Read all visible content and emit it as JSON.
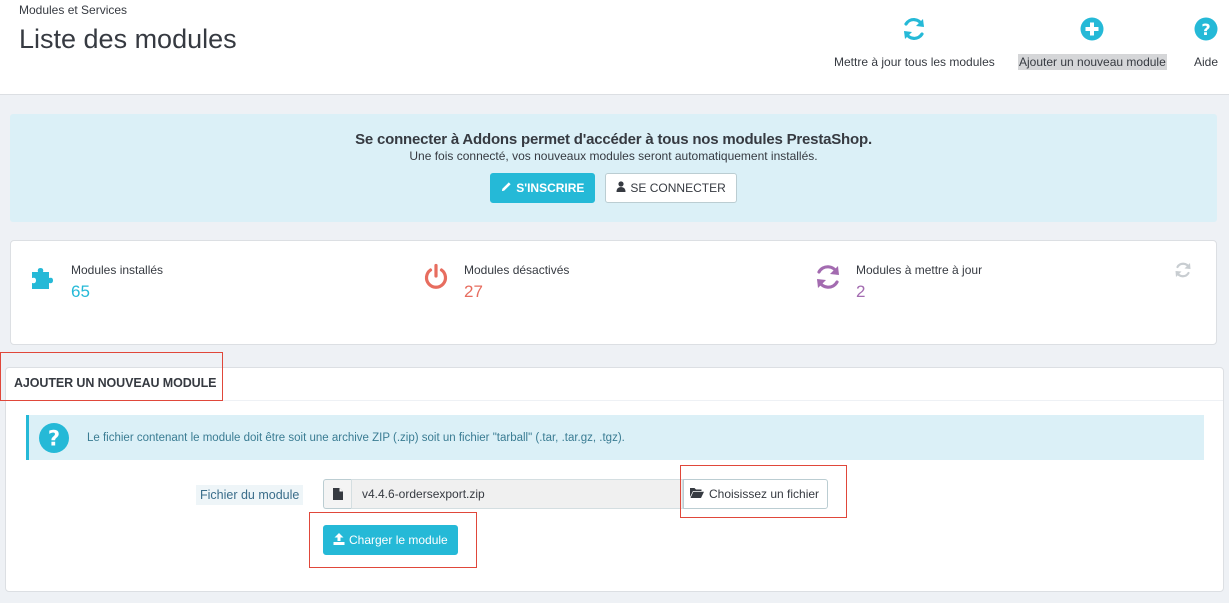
{
  "header": {
    "breadcrumb": "Modules et Services",
    "title": "Liste des modules",
    "toolbar": [
      {
        "label": "Mettre à jour tous les modules",
        "icon": "refresh-icon"
      },
      {
        "label": "Ajouter un nouveau module",
        "icon": "plus-circle-icon"
      },
      {
        "label": "Aide",
        "icon": "help-icon"
      }
    ]
  },
  "addons": {
    "title": "Se connecter à Addons permet d'accéder à tous nos modules PrestaShop.",
    "subtitle": "Une fois connecté, vos nouveaux modules seront automatiquement installés.",
    "signup_label": "S'INSCRIRE",
    "login_label": "SE CONNECTER"
  },
  "stats": {
    "installed": {
      "label": "Modules installés",
      "value": "65",
      "color": "#25b9d7"
    },
    "disabled": {
      "label": "Modules désactivés",
      "value": "27",
      "color": "#e76d5f"
    },
    "to_update": {
      "label": "Modules à mettre à jour",
      "value": "2",
      "color": "#a36bb0"
    }
  },
  "add_module": {
    "heading": "Ajouter un nouveau module",
    "info": "Le fichier contenant le module doit être soit une archive ZIP (.zip) soit un fichier \"tarball\" (.tar, .tar.gz, .tgz).",
    "file_label": "Fichier du module",
    "file_name": "v4.4.6-ordersexport.zip",
    "choose_label": "Choisissez un fichier",
    "upload_label": "Charger le module"
  },
  "colors": {
    "accent": "#25b9d7",
    "annotation": "#e0473a"
  }
}
